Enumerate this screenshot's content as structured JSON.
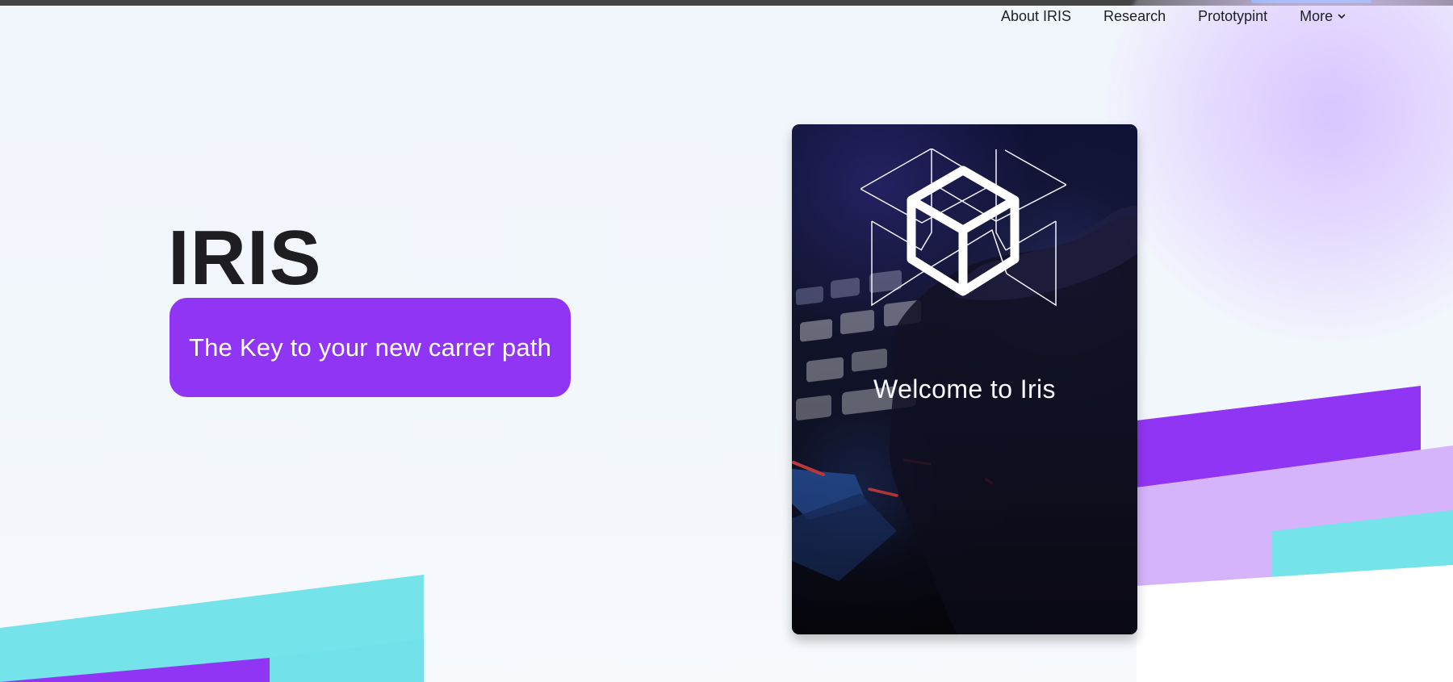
{
  "nav": {
    "items": [
      {
        "label": "About IRIS"
      },
      {
        "label": "Research"
      },
      {
        "label": "Prototypint"
      },
      {
        "label": "More",
        "has_chevron": true
      }
    ]
  },
  "hero": {
    "title": "IRIS",
    "tagline": "The Key to your new carrer path"
  },
  "card": {
    "caption": "Welcome to Iris",
    "logo_icon": "cube-logo-icon"
  },
  "colors": {
    "primary_purple": "#9135f4",
    "light_purple": "#d7b4fb",
    "cyan": "#74e3ea",
    "title_text": "#1d1d22"
  },
  "icons": {
    "more_chevron": "chevron-down-icon"
  }
}
